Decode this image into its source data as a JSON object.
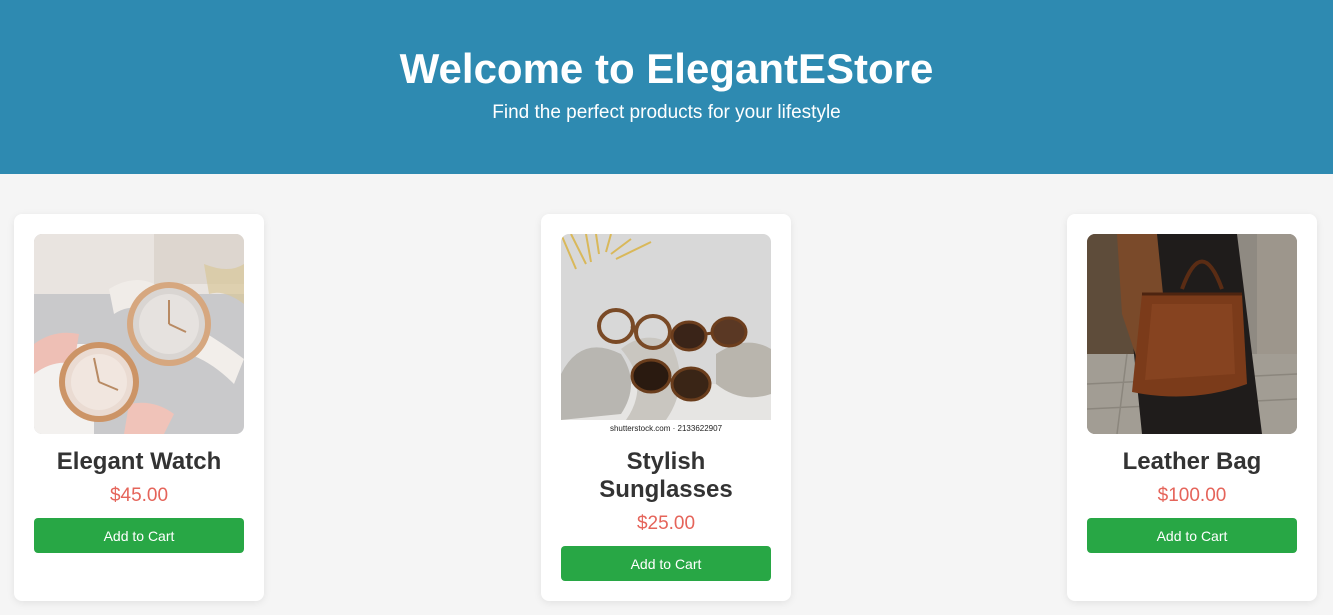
{
  "hero": {
    "title": "Welcome to ElegantEStore",
    "subtitle": "Find the perfect products for your lifestyle",
    "background": "#2e8ab1"
  },
  "products": [
    {
      "name": "Elegant Watch",
      "price": "$45.00",
      "button": "Add to Cart",
      "image": "watch-photo"
    },
    {
      "name": "Stylish Sunglasses",
      "price": "$25.00",
      "button": "Add to Cart",
      "image": "sunglasses-photo",
      "image_caption": "shutterstock.com · 2133622907"
    },
    {
      "name": "Leather Bag",
      "price": "$100.00",
      "button": "Add to Cart",
      "image": "leather-bag-photo"
    }
  ],
  "colors": {
    "price": "#e5645a",
    "button": "#28a745",
    "page_background": "#f5f5f5"
  }
}
